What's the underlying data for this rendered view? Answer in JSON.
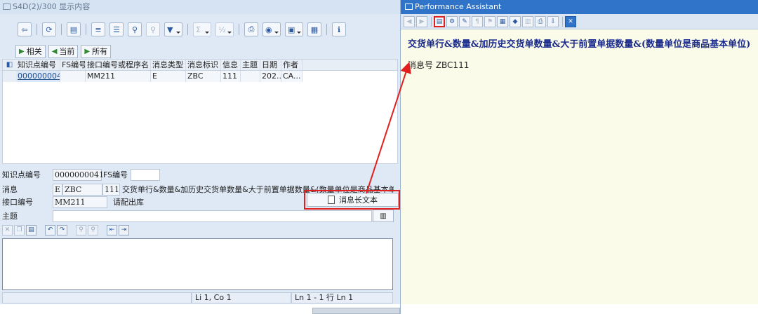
{
  "left_window": {
    "title": "S4D(2)/300 显示内容",
    "toolbar_buttons": [
      "back-arrow-icon",
      "refresh-icon",
      "details-icon",
      "sort-ascending-icon",
      "sort-descending-icon",
      "find-icon",
      "find-next-icon",
      "filter-icon",
      "sum-icon",
      "subtotal-icon",
      "print-icon",
      "export-icon",
      "view-icon",
      "layout-icon",
      "info-icon"
    ],
    "view_buttons": {
      "related": "相关",
      "current": "当前",
      "all": "所有"
    },
    "grid": {
      "columns": [
        "知识点编号",
        "FS编号",
        "接口编号或程序名",
        "消息类型",
        "消息标识",
        "信息",
        "主题",
        "日期",
        "作者"
      ],
      "rows": [
        [
          "0000000041",
          "",
          "MM211",
          "E",
          "ZBC",
          "111",
          "",
          "202...",
          "CA..."
        ]
      ]
    },
    "form": {
      "kp_label": "知识点编号",
      "kp_value": "0000000041",
      "fs_label": "FS编号",
      "fs_value": "",
      "msg_label": "消息",
      "msg_type": "E",
      "msg_class": "ZBC",
      "msg_number": "111",
      "msg_text": "交货单行&数量&加历史交货单数量&大于前置单据数量&(数量单位是商品基本单...",
      "iface_label": "接口编号",
      "iface_value": "MM211",
      "iface_desc": "请配出库",
      "longtext_button": "消息长文本",
      "subject_label": "主题",
      "subject_value": ""
    },
    "status": {
      "pos": "Li 1, Co 1",
      "lines": "Ln 1 - 1 行 Ln 1"
    }
  },
  "right_window": {
    "title": "Performance Assistant",
    "heading": "交货单行&数量&加历史交货单数量&大于前置单据数量&(数量单位是商品基本单位)",
    "message_number": "消息号 ZBC111"
  },
  "colors": {
    "highlight_red": "#e0201f",
    "pa_title_blue": "#2f74c8",
    "pa_heading": "#1a2a8c"
  }
}
